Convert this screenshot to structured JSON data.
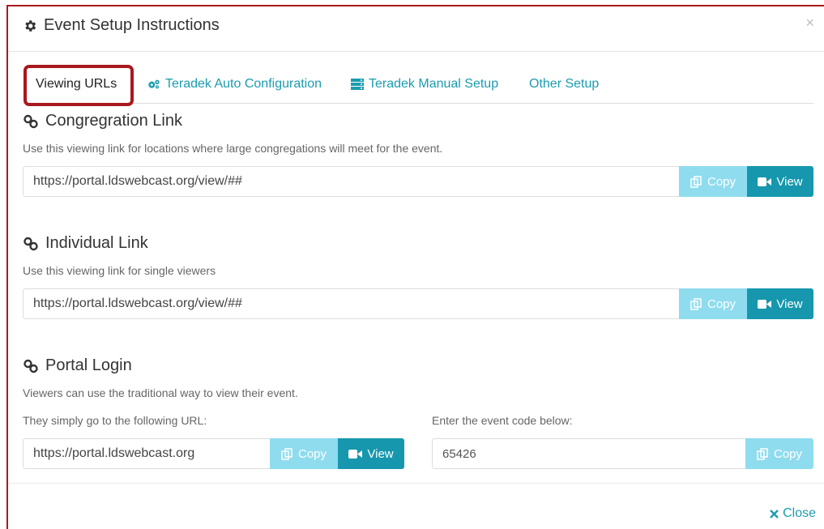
{
  "modal": {
    "title": "Event Setup Instructions",
    "title_icon": "gear-icon",
    "close_glyph": "×",
    "accent_color": "#1a9cb0",
    "highlight_color": "#a8191e"
  },
  "tabs": [
    {
      "label": "Viewing URLs",
      "icon": "",
      "active": true
    },
    {
      "label": "Teradek Auto Configuration",
      "icon": "cogs-icon",
      "active": false
    },
    {
      "label": "Teradek Manual Setup",
      "icon": "server-icon",
      "active": false
    },
    {
      "label": "Other Setup",
      "icon": "",
      "active": false
    }
  ],
  "congregation": {
    "title": "Congregration Link",
    "description": "Use this viewing link for locations where large congregations will meet for the event.",
    "url": "https://portal.ldswebcast.org/view/##",
    "copy_label": "Copy",
    "view_label": "View"
  },
  "individual": {
    "title": "Individual Link",
    "description": "Use this viewing link for single viewers",
    "url": "https://portal.ldswebcast.org/view/##",
    "copy_label": "Copy",
    "view_label": "View"
  },
  "portal": {
    "title": "Portal Login",
    "description": "Viewers can use the traditional way to view their event.",
    "url_label": "They simply go to the following URL:",
    "url": "https://portal.ldswebcast.org",
    "copy_label": "Copy",
    "view_label": "View",
    "code_label": "Enter the event code below:",
    "code": "65426",
    "code_copy_label": "Copy"
  },
  "footer": {
    "close_label": "Close"
  }
}
